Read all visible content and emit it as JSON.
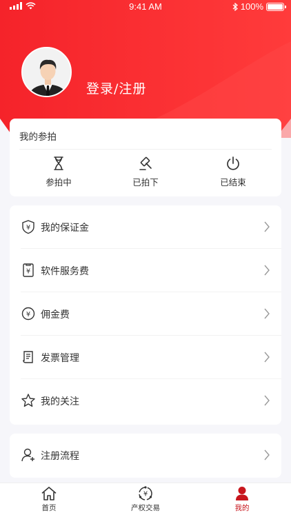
{
  "status_bar": {
    "time": "9:41 AM",
    "battery": "100%",
    "battery_level": 1.0
  },
  "profile": {
    "login_label": "登录/注册"
  },
  "auction": {
    "title": "我的参拍",
    "items": [
      {
        "label": "参拍中",
        "icon": "hourglass-icon"
      },
      {
        "label": "已拍下",
        "icon": "gavel-icon"
      },
      {
        "label": "已结束",
        "icon": "power-icon"
      }
    ]
  },
  "menu": [
    {
      "label": "我的保证金",
      "icon": "shield-yen-icon"
    },
    {
      "label": "软件服务费",
      "icon": "receipt-yen-icon"
    },
    {
      "label": "佣金费",
      "icon": "coin-yen-icon"
    },
    {
      "label": "发票管理",
      "icon": "document-icon"
    },
    {
      "label": "我的关注",
      "icon": "star-icon"
    }
  ],
  "menu2": [
    {
      "label": "注册流程",
      "icon": "user-add-icon"
    }
  ],
  "tabbar": [
    {
      "label": "首页",
      "icon": "home-icon"
    },
    {
      "label": "产权交易",
      "icon": "exchange-icon"
    },
    {
      "label": "我的",
      "icon": "person-icon",
      "active": true
    }
  ],
  "colors": {
    "brand_red": "#f0262b",
    "active_tab": "#c8161d"
  }
}
